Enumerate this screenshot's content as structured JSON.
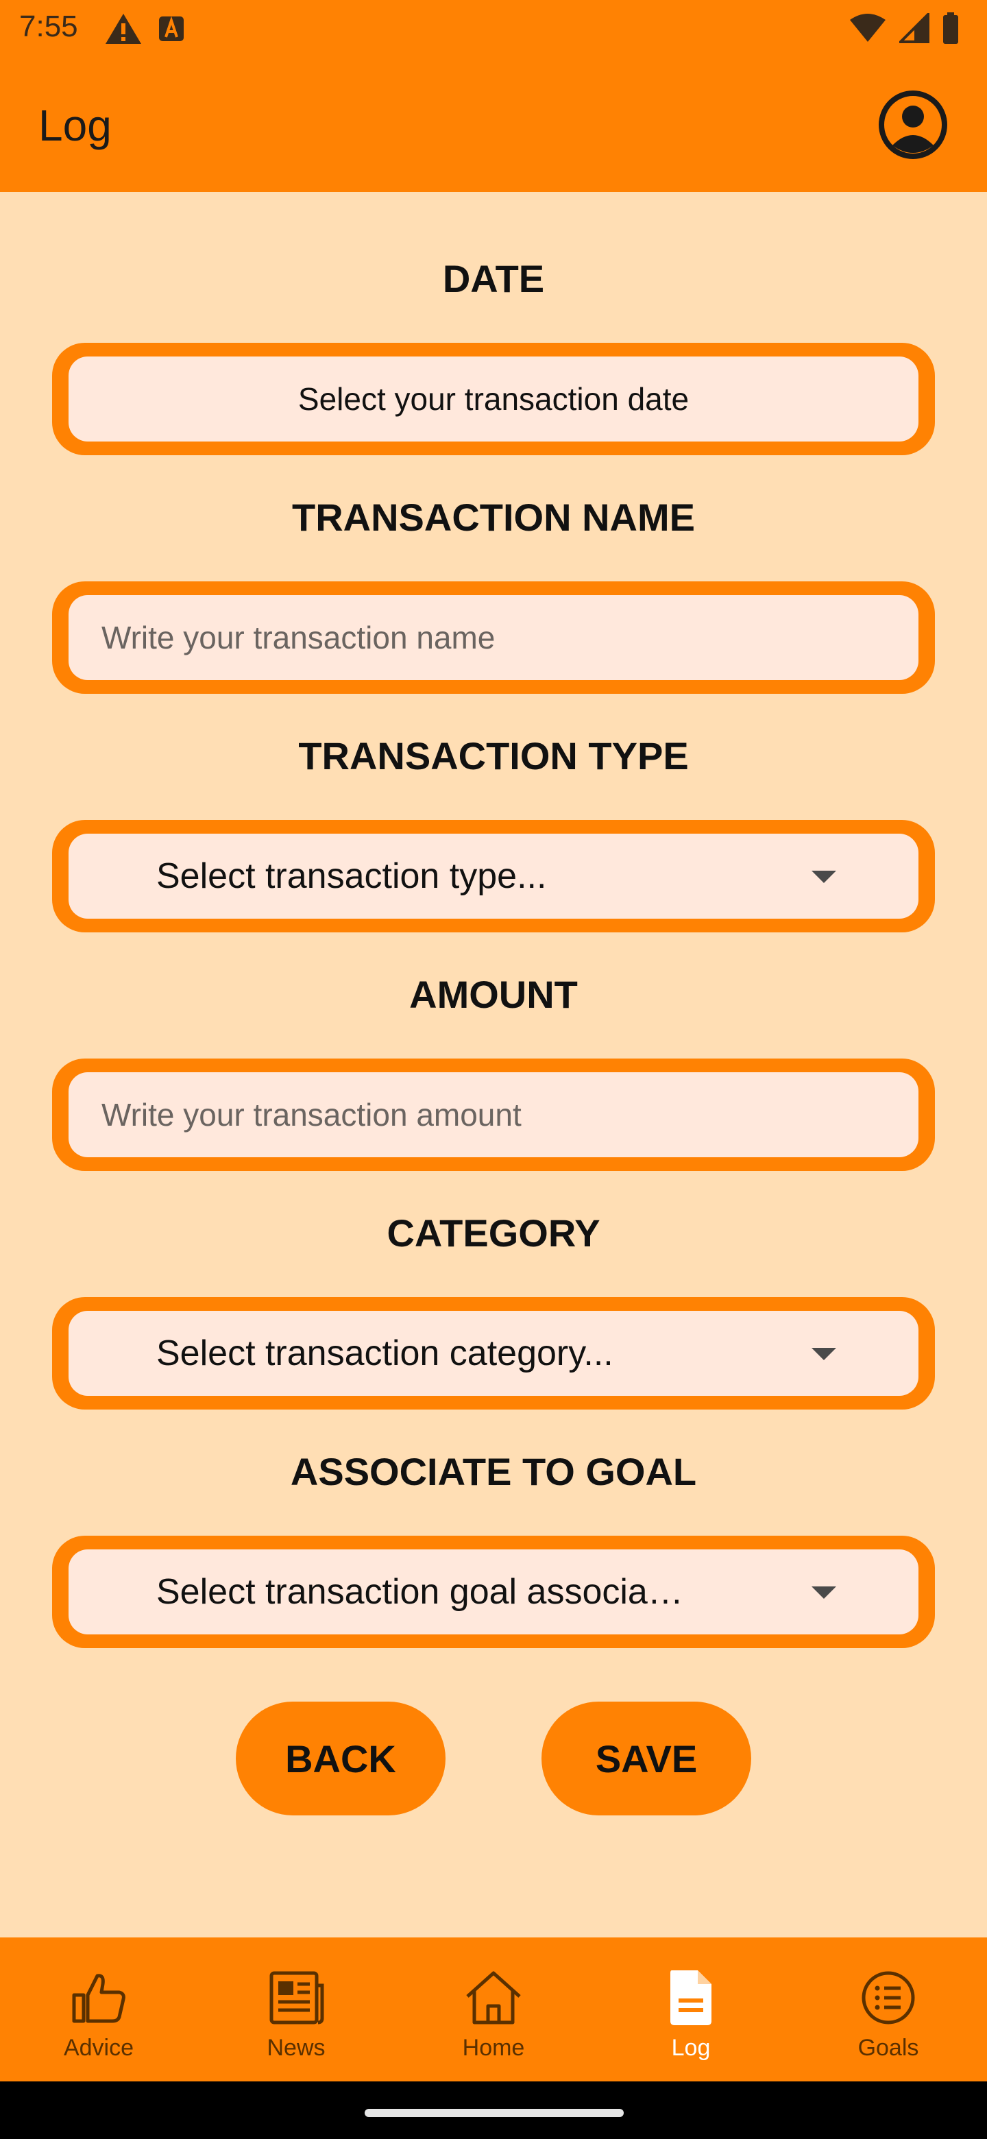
{
  "status_bar": {
    "time": "7:55"
  },
  "header": {
    "title": "Log"
  },
  "form": {
    "date": {
      "label": "DATE",
      "value": "Select your transaction date"
    },
    "transaction_name": {
      "label": "TRANSACTION NAME",
      "placeholder": "Write your transaction name"
    },
    "transaction_type": {
      "label": "TRANSACTION TYPE",
      "selected": "Select transaction type..."
    },
    "amount": {
      "label": "AMOUNT",
      "placeholder": "Write your transaction amount"
    },
    "category": {
      "label": "CATEGORY",
      "selected": "Select transaction category..."
    },
    "goal": {
      "label": "ASSOCIATE TO GOAL",
      "selected": "Select transaction goal associa…"
    }
  },
  "actions": {
    "back_label": "BACK",
    "save_label": "SAVE"
  },
  "bottom_nav": {
    "items": [
      {
        "label": "Advice",
        "icon": "thumbs-up-icon"
      },
      {
        "label": "News",
        "icon": "newspaper-icon"
      },
      {
        "label": "Home",
        "icon": "home-icon"
      },
      {
        "label": "Log",
        "icon": "document-icon",
        "active": true
      },
      {
        "label": "Goals",
        "icon": "list-icon"
      }
    ]
  },
  "colors": {
    "primary": "#ff8203",
    "background": "#ffdeb4",
    "field_fill": "#ffe8dc"
  }
}
